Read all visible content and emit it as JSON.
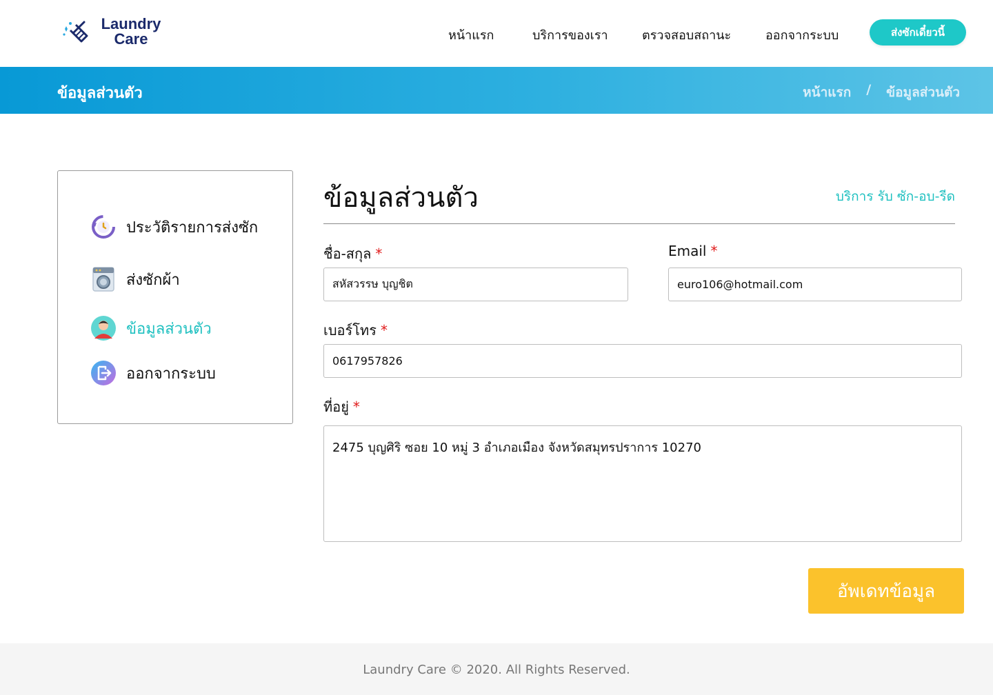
{
  "header": {
    "logo_line1": "Laundry",
    "logo_line2": "Care",
    "nav": [
      "หน้าแรก",
      "บริการของเรา",
      "ตรวจสอบสถานะ",
      "ออกจากระบบ"
    ],
    "cta_label": "ส่งซักเดี๋ยวนี้"
  },
  "banner": {
    "title": "ข้อมูลส่วนตัว",
    "breadcrumb": [
      "หน้าแรก",
      "/",
      "ข้อมูลส่วนตัว"
    ]
  },
  "sidebar": {
    "items": [
      {
        "label": "ประวัติรายการส่งซัก",
        "icon": "history-icon",
        "active": false
      },
      {
        "label": "ส่งซักผ้า",
        "icon": "washing-machine-icon",
        "active": false
      },
      {
        "label": "ข้อมูลส่วนตัว",
        "icon": "user-avatar-icon",
        "active": true
      },
      {
        "label": "ออกจากระบบ",
        "icon": "logout-icon",
        "active": false
      }
    ]
  },
  "main": {
    "title": "ข้อมูลส่วนตัว",
    "tagline": "บริการ รับ ซัก-อบ-รีด",
    "form": {
      "name_label": "ชื่อ-สกุล",
      "name_value": "สหัสวรรษ บุญชิต",
      "email_label": "Email",
      "email_value": "euro106@hotmail.com",
      "phone_label": "เบอร์โทร",
      "phone_value": "0617957826",
      "address_label": "ที่อยู่",
      "address_value": "2475 บุญศิริ ซอย 10 หมู่ 3 อำเภอเมือง จังหวัดสมุทรปราการ 10270",
      "required_mark": "*",
      "submit_label": "อัพเดทข้อมูล"
    }
  },
  "footer": {
    "text": "Laundry Care © 2020. All Rights Reserved."
  },
  "colors": {
    "accent": "#1ec8c8",
    "banner_start": "#0899d6",
    "banner_end": "#5dc4e6",
    "submit": "#fbc22c",
    "required": "#e01b1b"
  }
}
